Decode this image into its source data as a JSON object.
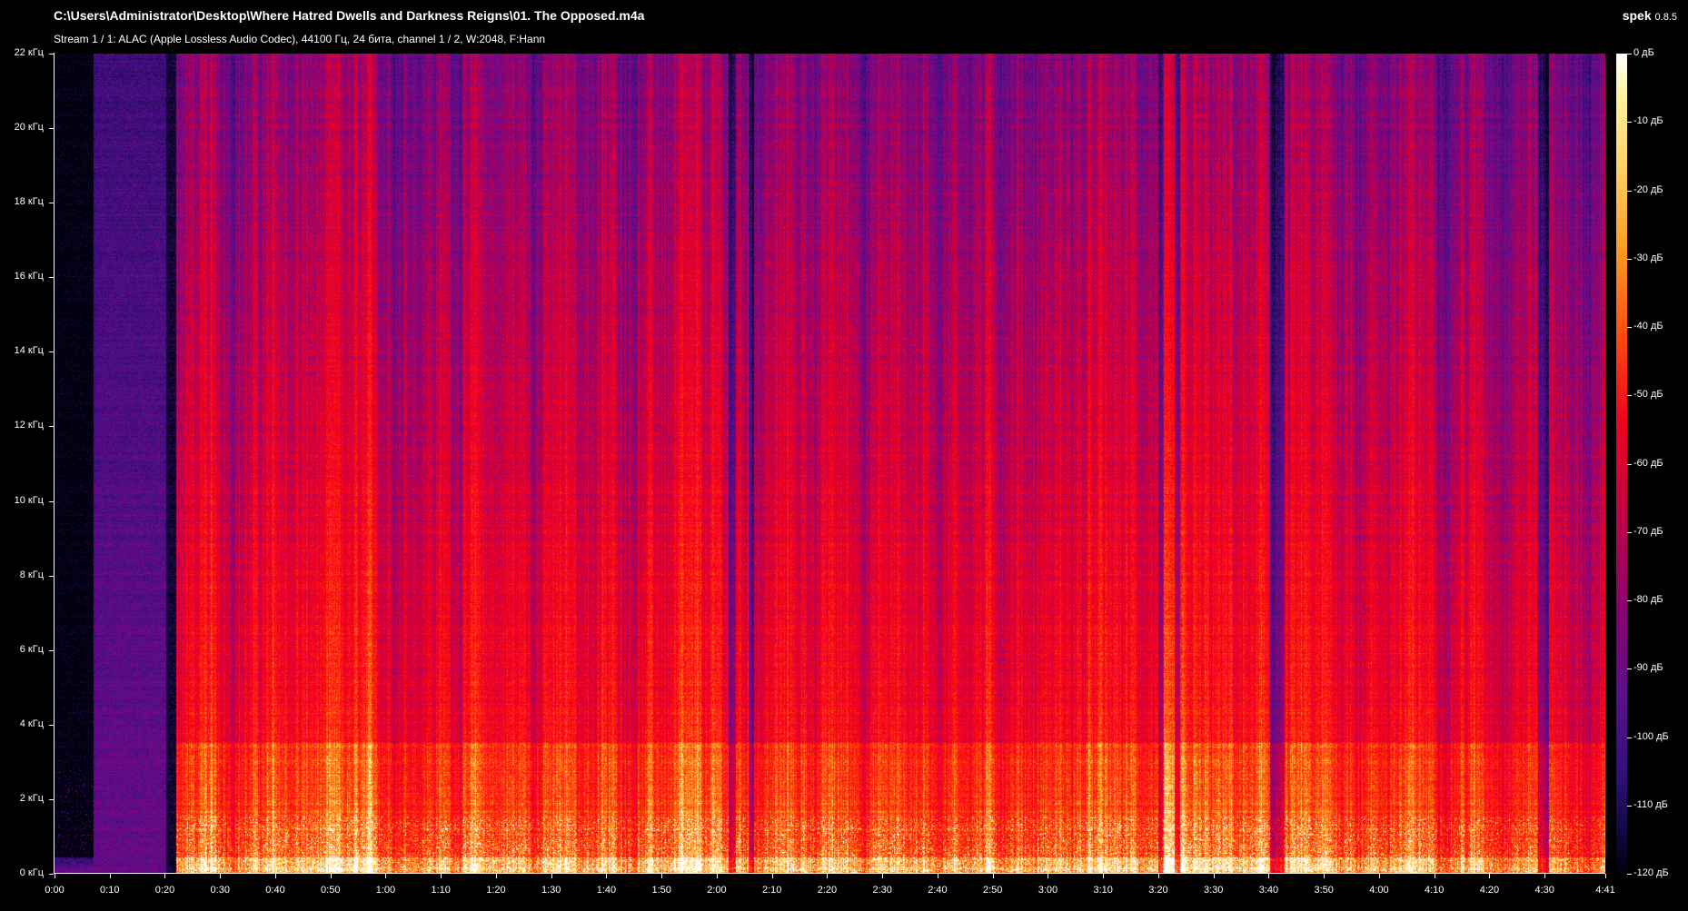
{
  "window": {
    "title": "C:\\Users\\Administrator\\Desktop\\Where Hatred Dwells and Darkness Reigns\\01. The Opposed.m4a",
    "app_name": "spek",
    "app_version": "0.8.5",
    "stream_info": "Stream 1 / 1: ALAC (Apple Lossless Audio Codec), 44100 Гц, 24 бита, channel 1 / 2, W:2048, F:Hann"
  },
  "spectrogram": {
    "frequency_labels": [
      "22 кГц",
      "20 кГц",
      "18 кГц",
      "16 кГц",
      "14 кГц",
      "12 кГц",
      "10 кГц",
      "8 кГц",
      "6 кГц",
      "4 кГц",
      "2 кГц",
      "0 кГц"
    ],
    "time_labels": [
      "0:00",
      "0:10",
      "0:20",
      "0:30",
      "0:40",
      "0:50",
      "1:00",
      "1:10",
      "1:20",
      "1:30",
      "1:40",
      "1:50",
      "2:00",
      "2:10",
      "2:20",
      "2:30",
      "2:40",
      "2:50",
      "3:00",
      "3:10",
      "3:20",
      "3:30",
      "3:40",
      "3:50",
      "4:00",
      "4:10",
      "4:20",
      "4:30",
      "4:41"
    ],
    "time_seconds": [
      0,
      10,
      20,
      30,
      40,
      50,
      60,
      70,
      80,
      90,
      100,
      110,
      120,
      130,
      140,
      150,
      160,
      170,
      180,
      190,
      200,
      210,
      220,
      230,
      240,
      250,
      260,
      270,
      281
    ],
    "frequency_khz": [
      22,
      20,
      18,
      16,
      14,
      12,
      10,
      8,
      6,
      4,
      2,
      0
    ],
    "duration_seconds": 281,
    "max_frequency_khz": 22
  },
  "colorbar": {
    "labels": [
      "0 дБ",
      "-10 дБ",
      "-20 дБ",
      "-30 дБ",
      "-40 дБ",
      "-50 дБ",
      "-60 дБ",
      "-70 дБ",
      "-80 дБ",
      "-90 дБ",
      "-100 дБ",
      "-110 дБ",
      "-120 дБ"
    ],
    "db_values": [
      0,
      -10,
      -20,
      -30,
      -40,
      -50,
      -60,
      -70,
      -80,
      -90,
      -100,
      -110,
      -120
    ]
  }
}
